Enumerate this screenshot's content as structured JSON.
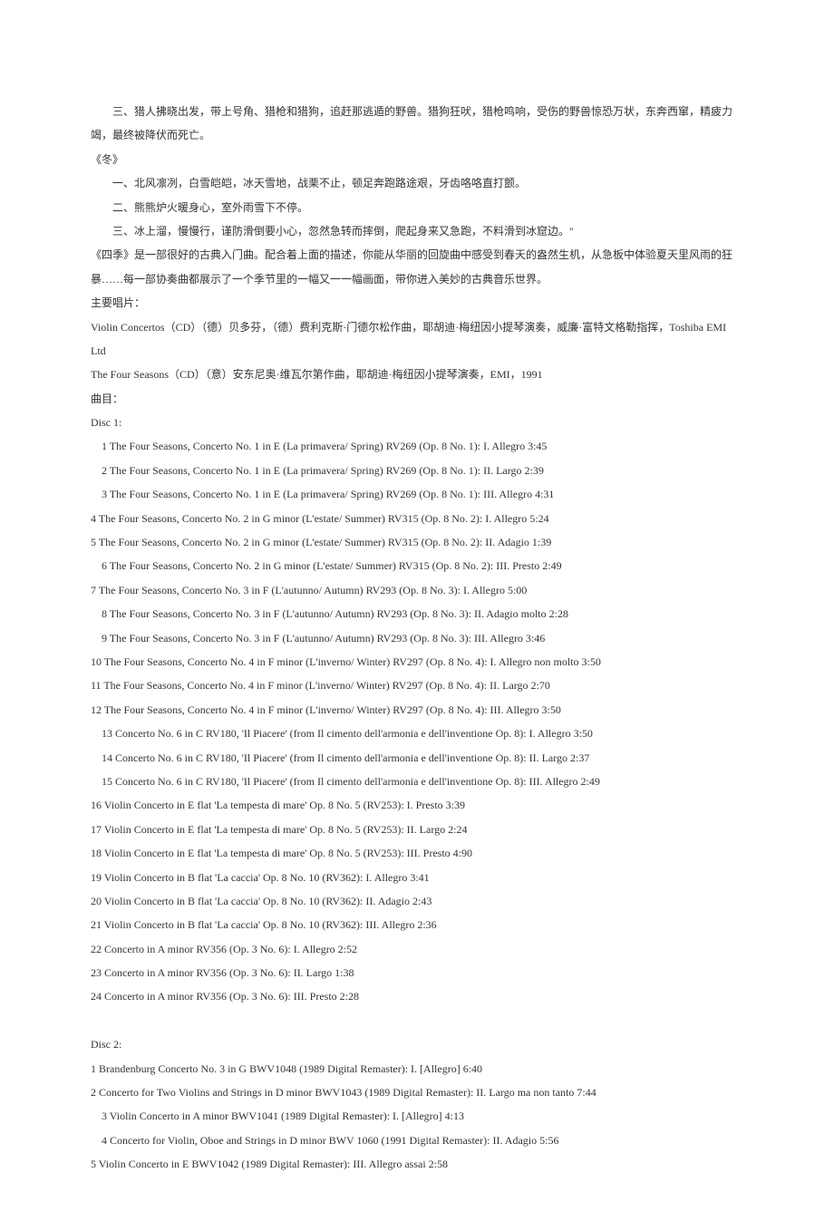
{
  "intro": {
    "autumn3": "三、猎人拂晓出发，带上号角、猎枪和猎狗，追赶那逃遁的野兽。猎狗狂吠，猎枪鸣响，受伤的野兽惊恐万状，东奔西窜，精疲力竭，最终被降伏而死亡。",
    "winter_title": "《冬》",
    "winter1": "一、北风凛冽，白雪皑皑，冰天雪地，战栗不止，顿足奔跑路途艰，牙齿咯咯直打颤。",
    "winter2": "二、熊熊炉火暖身心，室外雨雪下不停。",
    "winter3": "三、冰上溜，慢慢行，谨防滑倒要小心，忽然急转而摔倒，爬起身来又急跑，不料滑到冰窟边。\"",
    "four_seasons_desc": "《四季》是一部很好的古典入门曲。配合着上面的描述，你能从华丽的回旋曲中感受到春天的盎然生机，从急板中体验夏天里风雨的狂暴……每一部协奏曲都展示了一个季节里的一幅又一一幅画面，带你进入美妙的古典音乐世界。",
    "main_records_label": "主要唱片：",
    "record1": "Violin Concertos（CD）（德）贝多芬，（德）费利克斯·门德尔松作曲，耶胡迪·梅纽因小提琴演奏，威廉·富特文格勒指挥，Toshiba EMI Ltd",
    "record2": "The Four Seasons（CD）（意）安东尼奥·维瓦尔第作曲，耶胡迪·梅纽因小提琴演奏，EMI，1991",
    "tracks_label": "曲目："
  },
  "disc1": {
    "title": "Disc 1:",
    "tracks": [
      "1 The Four Seasons, Concerto No. 1 in E (La primavera/ Spring) RV269 (Op. 8 No. 1): I. Allegro 3:45",
      "2 The Four Seasons, Concerto No. 1 in E (La primavera/ Spring) RV269 (Op. 8 No. 1): II. Largo 2:39",
      "3 The Four Seasons, Concerto No. 1 in E (La primavera/ Spring) RV269 (Op. 8 No. 1): III. Allegro 4:31",
      "4 The Four Seasons, Concerto No. 2 in G minor (L'estate/ Summer) RV315 (Op. 8 No. 2): I. Allegro 5:24",
      "5 The Four Seasons, Concerto No. 2 in G minor (L'estate/ Summer) RV315 (Op. 8 No. 2): II. Adagio 1:39",
      "6 The Four Seasons, Concerto No. 2 in G minor (L'estate/ Summer) RV315 (Op. 8 No. 2): III. Presto 2:49",
      "7 The Four Seasons, Concerto No. 3 in F (L'autunno/ Autumn) RV293 (Op. 8 No. 3): I. Allegro 5:00",
      "8 The Four Seasons, Concerto No. 3 in F (L'autunno/ Autumn) RV293 (Op. 8 No. 3): II. Adagio molto 2:28",
      "9 The Four Seasons, Concerto No. 3 in F (L'autunno/ Autumn) RV293 (Op. 8 No. 3): III. Allegro 3:46",
      "10 The Four Seasons, Concerto No. 4 in F minor (L'inverno/ Winter) RV297 (Op. 8 No. 4): I. Allegro non molto 3:50",
      "11 The Four Seasons, Concerto No. 4 in F minor (L'inverno/ Winter) RV297 (Op. 8 No. 4): II. Largo 2:70",
      "12 The Four Seasons, Concerto No. 4 in F minor (L'inverno/ Winter) RV297 (Op. 8 No. 4): III. Allegro 3:50",
      "13 Concerto No. 6 in C RV180, 'Il Piacere' (from Il cimento dell'armonia e dell'inventione Op. 8): I. Allegro 3:50",
      "14 Concerto No. 6 in C RV180, 'Il Piacere' (from Il cimento dell'armonia e dell'inventione Op. 8): II. Largo 2:37",
      "15 Concerto No. 6 in C RV180, 'Il Piacere' (from Il cimento dell'armonia e dell'inventione Op. 8): III. Allegro 2:49",
      "16 Violin Concerto in E flat 'La tempesta di mare' Op. 8 No. 5 (RV253): I. Presto 3:39",
      "17 Violin Concerto in E flat 'La tempesta di mare' Op. 8 No. 5 (RV253): II. Largo 2:24",
      "18 Violin Concerto in E flat 'La tempesta di mare' Op. 8 No. 5 (RV253): III. Presto 4:90",
      "19 Violin Concerto in B flat 'La caccia' Op. 8 No. 10 (RV362): I. Allegro 3:41",
      "20 Violin Concerto in B flat 'La caccia' Op. 8 No. 10 (RV362): II. Adagio 2:43",
      "21 Violin Concerto in B flat 'La caccia' Op. 8 No. 10 (RV362): III. Allegro 2:36",
      "22 Concerto in A minor RV356 (Op. 3 No. 6): I. Allegro 2:52",
      "23 Concerto in A minor RV356 (Op. 3 No. 6): II. Largo 1:38",
      "24 Concerto in A minor RV356 (Op. 3 No. 6): III. Presto 2:28"
    ],
    "indents": [
      1,
      1,
      1,
      0,
      0,
      1,
      0,
      1,
      1,
      0,
      0,
      0,
      1,
      1,
      1,
      0,
      0,
      0,
      0,
      0,
      0,
      0,
      0,
      0
    ]
  },
  "disc2": {
    "title": "Disc 2:",
    "tracks": [
      "1 Brandenburg Concerto No. 3 in G BWV1048 (1989 Digital Remaster): I. [Allegro] 6:40",
      "2 Concerto for Two Violins and Strings in D minor BWV1043 (1989 Digital Remaster): II. Largo ma non tanto 7:44",
      "3 Violin Concerto in A minor BWV1041 (1989 Digital Remaster): I. [Allegro] 4:13",
      "4 Concerto for Violin, Oboe and Strings in D minor BWV 1060 (1991 Digital Remaster): II. Adagio 5:56",
      "5 Violin Concerto in E BWV1042 (1989 Digital Remaster): III. Allegro assai 2:58"
    ],
    "indents": [
      0,
      0,
      1,
      1,
      0
    ]
  }
}
